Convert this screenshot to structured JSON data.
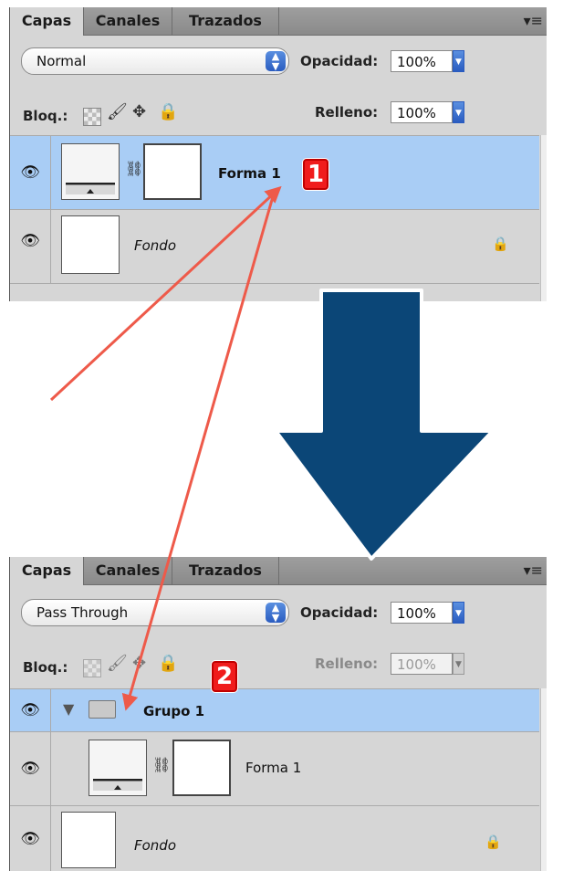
{
  "panel_top": {
    "tabs": [
      "Capas",
      "Canales",
      "Trazados"
    ],
    "blend_mode": "Normal",
    "opacity_label": "Opacidad:",
    "opacity_value": "100%",
    "lock_label": "Bloq.:",
    "fill_label": "Relleno:",
    "fill_value": "100%",
    "layers": [
      {
        "name": "Forma 1"
      },
      {
        "name": "Fondo"
      }
    ],
    "badge": "1"
  },
  "panel_bottom": {
    "tabs": [
      "Capas",
      "Canales",
      "Trazados"
    ],
    "blend_mode": "Pass Through",
    "opacity_label": "Opacidad:",
    "opacity_value": "100%",
    "lock_label": "Bloq.:",
    "fill_label": "Relleno:",
    "fill_value": "100%",
    "layers": [
      {
        "name": "Grupo 1"
      },
      {
        "name": "Forma 1"
      },
      {
        "name": "Fondo"
      }
    ],
    "badge": "2"
  },
  "colors": {
    "arrow_blue": "#0b4677",
    "annotation_red": "#ee5a4a",
    "selection_blue": "#a9cdf5"
  },
  "icons": [
    "eye-icon",
    "link-chain-icon",
    "lock-icon",
    "folder-icon",
    "disclosure-triangle-icon",
    "panel-menu-icon",
    "move-icon",
    "brush-icon"
  ]
}
